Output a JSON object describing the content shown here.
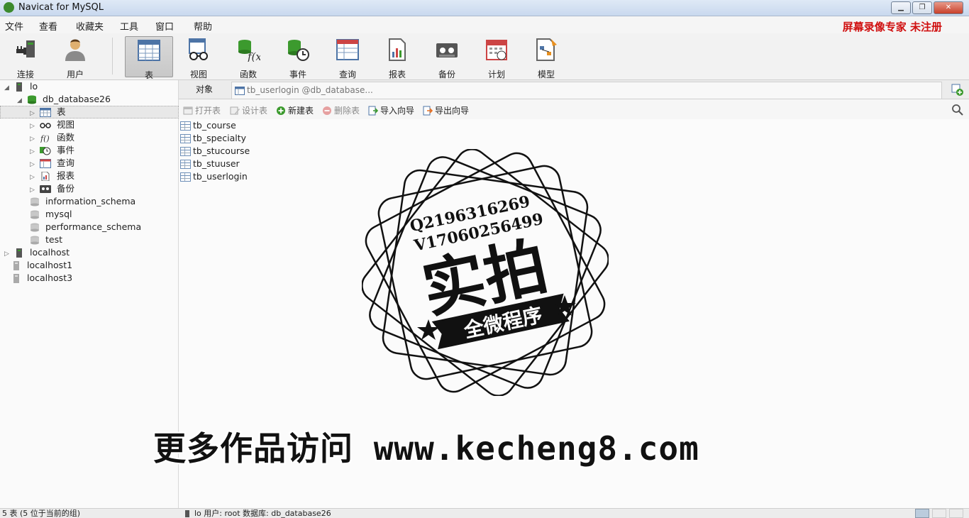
{
  "window": {
    "title": "Navicat for MySQL",
    "minimize": "▁",
    "maximize": "❐",
    "close": "✕"
  },
  "menu": {
    "items": [
      "文件",
      "查看",
      "收藏夹",
      "工具",
      "窗口",
      "帮助"
    ],
    "registration": "屏幕录像专家  未注册"
  },
  "toolbar": {
    "buttons": [
      {
        "label": "连接",
        "icon": "plug-icon"
      },
      {
        "label": "用户",
        "icon": "user-icon"
      },
      {
        "label": "表",
        "icon": "table-icon",
        "active": true
      },
      {
        "label": "视图",
        "icon": "view-glasses-icon"
      },
      {
        "label": "函数",
        "icon": "function-icon"
      },
      {
        "label": "事件",
        "icon": "event-clock-icon"
      },
      {
        "label": "查询",
        "icon": "query-icon"
      },
      {
        "label": "报表",
        "icon": "report-icon"
      },
      {
        "label": "备份",
        "icon": "backup-tape-icon"
      },
      {
        "label": "计划",
        "icon": "calendar-icon"
      },
      {
        "label": "模型",
        "icon": "model-icon"
      }
    ]
  },
  "sidebar": {
    "connection_lo": "lo",
    "database": "db_database26",
    "db_children": [
      "表",
      "视图",
      "函数",
      "事件",
      "查询",
      "报表",
      "备份"
    ],
    "other_dbs": [
      "information_schema",
      "mysql",
      "performance_schema",
      "test"
    ],
    "connections": [
      "localhost",
      "localhost1",
      "localhost3"
    ]
  },
  "tabs": {
    "objects": "对象",
    "doc": "tb_userlogin @db_database..."
  },
  "object_toolbar": {
    "open": "打开表",
    "design": "设计表",
    "new": "新建表",
    "delete": "删除表",
    "import": "导入向导",
    "export": "导出向导"
  },
  "tables": [
    "tb_course",
    "tb_specialty",
    "tb_stucourse",
    "tb_stuuser",
    "tb_userlogin"
  ],
  "stamp": {
    "line1": "Q2196316269",
    "line2": "V17060256499",
    "main": "实拍",
    "banner": "全微程序"
  },
  "watermark": {
    "cn": "更多作品访问",
    "url": "www.kecheng8.com"
  },
  "status": {
    "left": "5 表 (5 位于当前的组)",
    "right": "lo   用户: root   数据库: db_database26"
  },
  "colors": {
    "accent_red": "#d01010",
    "db_green": "#3c9a2e",
    "table_blue": "#6d8fb8"
  }
}
